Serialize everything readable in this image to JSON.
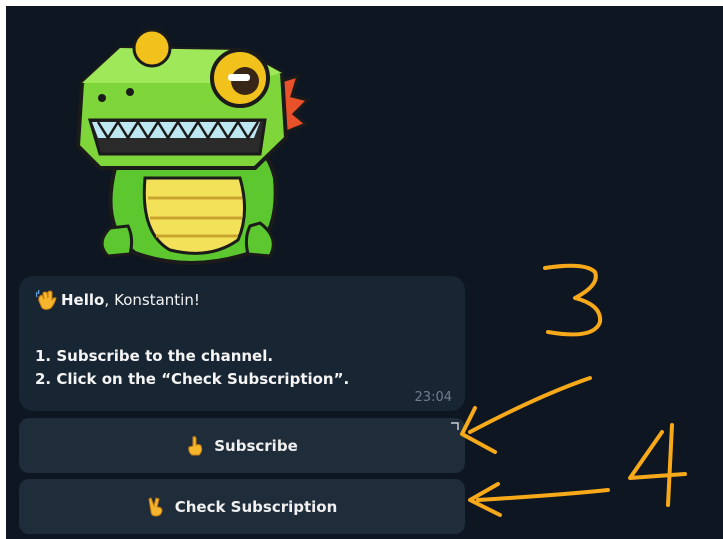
{
  "message": {
    "greeting_bold": "Hello",
    "greeting_comma": ",",
    "greeting_name": "Konstantin!",
    "step1": "1. Subscribe to the channel.",
    "step2": "2. Click on the “Check Subscription”.",
    "time": "23:04"
  },
  "buttons": {
    "subscribe_label": "Subscribe",
    "check_label": "Check Subscription"
  },
  "annotations": {
    "label_3": "3",
    "label_4": "4"
  },
  "icons": {
    "sticker": "green-dinosaur-sticker",
    "wave": "waving-hand-emoji",
    "pointing": "pointing-up-emoji",
    "victory": "victory-hand-emoji"
  },
  "colors": {
    "chat_bg": "#0e1621",
    "bubble_bg": "#182533",
    "button_bg": "#1f2c3a",
    "annotation": "#f7a91a"
  }
}
